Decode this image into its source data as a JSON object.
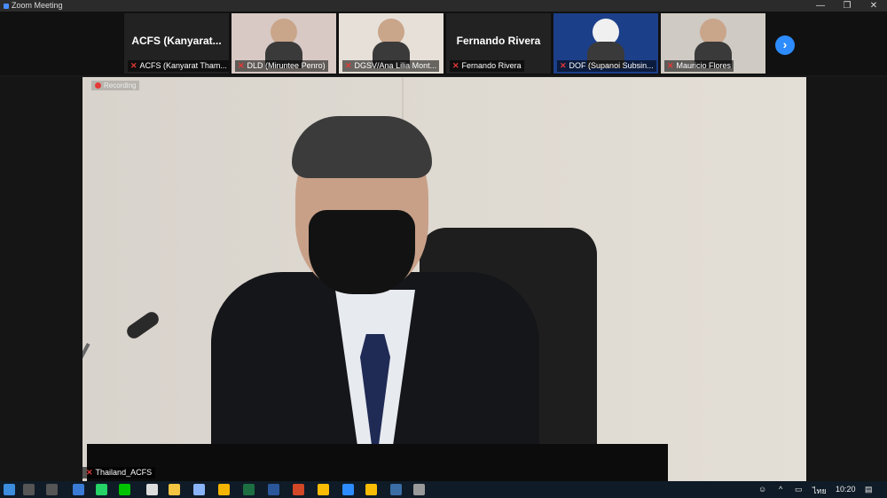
{
  "window": {
    "title": "Zoom Meeting",
    "minimize": "—",
    "restore": "❐",
    "close": "✕"
  },
  "participants": [
    {
      "tile_title": "ACFS  (Kanyarat...",
      "label": "ACFS (Kanyarat Tham...",
      "video": false
    },
    {
      "tile_title": "",
      "label": "DLD  (Miruntee Penro)",
      "video": true
    },
    {
      "tile_title": "",
      "label": "DGSV/Ana Lilia Mont...",
      "video": true
    },
    {
      "tile_title": "Fernando Rivera",
      "label": "Fernando Rivera",
      "video": false
    },
    {
      "tile_title": "",
      "label": "DOF (Supanoi Subsin...",
      "video": true
    },
    {
      "tile_title": "",
      "label": "Mauricio Flores",
      "video": true
    }
  ],
  "next_arrow": "›",
  "main_video": {
    "recording": "Recording",
    "speaker_label": "Thailand_ACFS"
  },
  "taskbar": {
    "time": "10:20",
    "lang": "ไทย"
  },
  "colors": {
    "accent": "#2d8cff",
    "mute": "#e53935"
  }
}
